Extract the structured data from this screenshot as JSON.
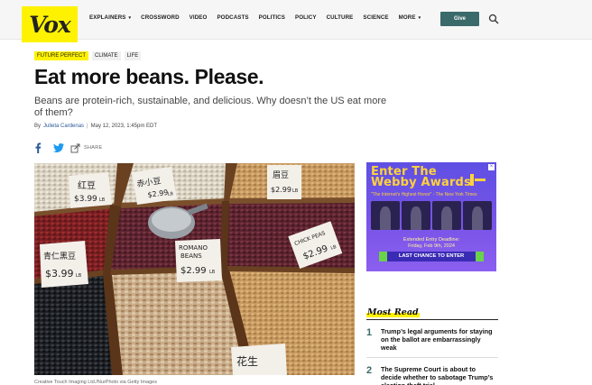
{
  "header": {
    "logo_text": "Vox",
    "nav": [
      {
        "label": "EXPLAINERS",
        "has_dropdown": true
      },
      {
        "label": "CROSSWORD",
        "has_dropdown": false
      },
      {
        "label": "VIDEO",
        "has_dropdown": false
      },
      {
        "label": "PODCASTS",
        "has_dropdown": false
      },
      {
        "label": "POLITICS",
        "has_dropdown": false
      },
      {
        "label": "POLICY",
        "has_dropdown": false
      },
      {
        "label": "CULTURE",
        "has_dropdown": false
      },
      {
        "label": "SCIENCE",
        "has_dropdown": false
      },
      {
        "label": "MORE",
        "has_dropdown": true
      }
    ],
    "give_label": "Give",
    "search_icon": "search-icon"
  },
  "article": {
    "tags": [
      {
        "label": "FUTURE PERFECT",
        "highlight": true
      },
      {
        "label": "CLIMATE",
        "highlight": false
      },
      {
        "label": "LIFE",
        "highlight": false
      }
    ],
    "headline": "Eat more beans. Please.",
    "dek": "Beans are protein-rich, sustainable, and delicious. Why doesn’t the US eat more of them?",
    "byline_prefix": "By",
    "author": "Julieta Cardenas",
    "separator": "|",
    "date": "May 12, 2023, 1:45pm EDT",
    "share_label": "SHARE",
    "caption": "Creative Touch Imaging Ltd./NurPhoto via Getty Images",
    "photo_signs": [
      "红豆",
      "$3.99",
      "LB",
      "赤小豆",
      "$2.99",
      "LB",
      "眉豆",
      "$2.99",
      "LB",
      "青仁黑豆",
      "$3.99",
      "LB",
      "ROMANO",
      "BEANS",
      "$2.99",
      "LB",
      "CHICK PEAS",
      "$2.99",
      "LB",
      "花生"
    ]
  },
  "ad": {
    "title_line1": "Enter The",
    "title_line2": "Webby Awards",
    "quote": "\"The Internet's Highest Honor\" - The New York Times",
    "deadline_line1": "Extended Entry Deadline:",
    "deadline_line2": "Friday, Feb 9th, 2024",
    "cta": "LAST CHANCE TO ENTER",
    "close_glyph": "×",
    "colors": {
      "bg": "#5f4fe3",
      "title": "#ffd23a",
      "cta": "#3a2bb5"
    }
  },
  "most_read": {
    "title": "Most Read",
    "items": [
      {
        "num": "1",
        "text": "Trump’s legal arguments for staying on the ballot are embarrassingly weak"
      },
      {
        "num": "2",
        "text": "The Supreme Court is about to decide whether to sabotage Trump’s election theft trial"
      }
    ]
  },
  "colors": {
    "brand_yellow": "#fff200",
    "give_button": "#3a6a6a",
    "link": "#2a5a9a"
  }
}
